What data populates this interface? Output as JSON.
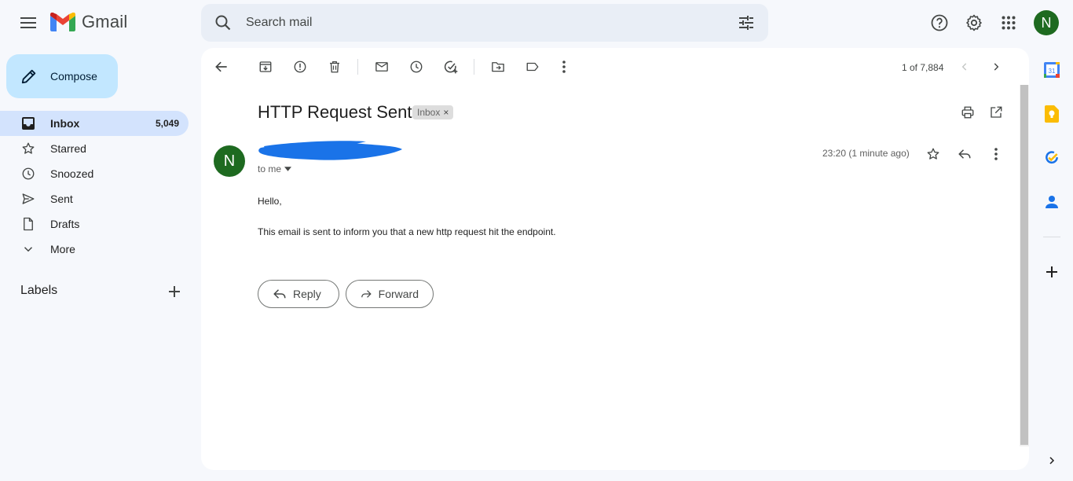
{
  "app": {
    "name": "Gmail"
  },
  "search": {
    "placeholder": "Search mail"
  },
  "account": {
    "initial": "N"
  },
  "compose_label": "Compose",
  "sidebar": {
    "items": [
      {
        "label": "Inbox",
        "count": "5,049",
        "icon": "inbox-icon",
        "active": true
      },
      {
        "label": "Starred",
        "icon": "star-icon"
      },
      {
        "label": "Snoozed",
        "icon": "clock-icon"
      },
      {
        "label": "Sent",
        "icon": "send-icon"
      },
      {
        "label": "Drafts",
        "icon": "draft-icon"
      },
      {
        "label": "More",
        "icon": "chevron-down-icon"
      }
    ],
    "labels_heading": "Labels"
  },
  "toolbar": {
    "icons": [
      "back-arrow-icon",
      "archive-icon",
      "report-spam-icon",
      "delete-icon",
      "mark-unread-icon",
      "snooze-icon",
      "add-to-tasks-icon",
      "move-to-icon",
      "label-icon",
      "more-vert-icon"
    ],
    "pagination": "1 of 7,884"
  },
  "email": {
    "subject": "HTTP Request Sent",
    "label_chip": "Inbox",
    "sender_initial": "N",
    "recipient": "to me",
    "timestamp": "23:20 (1 minute ago)",
    "greeting": "Hello,",
    "body": "This email is sent to inform you that a new http request hit the endpoint.",
    "reply_label": "Reply",
    "forward_label": "Forward"
  },
  "right_rail": [
    "calendar-icon",
    "keep-icon",
    "tasks-icon",
    "contacts-icon",
    "add-icon",
    "expand-icon"
  ],
  "colors": {
    "accent": "#0b57d0",
    "compose_bg": "#c2e7ff",
    "active_nav": "#d3e3fd",
    "avatar": "#1e6a20",
    "redaction": "#1a73e8"
  }
}
